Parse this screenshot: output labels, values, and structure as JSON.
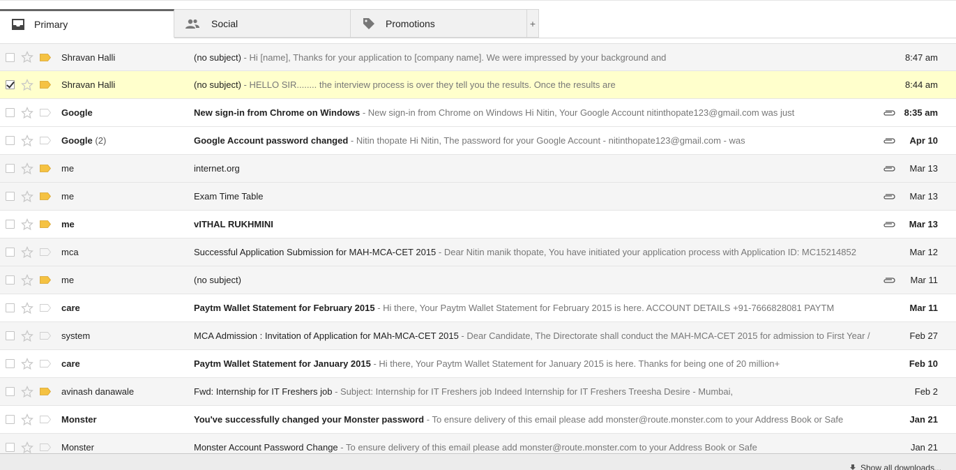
{
  "tabs": [
    {
      "label": "Primary",
      "icon": "inbox-icon"
    },
    {
      "label": "Social",
      "icon": "people-icon"
    },
    {
      "label": "Promotions",
      "icon": "tag-icon"
    }
  ],
  "tab_add_label": "+",
  "emails": [
    {
      "sender": "Shravan Halli",
      "count": "",
      "subject": "(no subject)",
      "snippet": " - Hi [name], Thanks for your application to [company name]. We were impressed by your background and",
      "date": "8:47 am",
      "unread": false,
      "selected": false,
      "checked": false,
      "important": true,
      "attachment": false
    },
    {
      "sender": "Shravan Halli",
      "count": "",
      "subject": "(no subject)",
      "snippet": " - HELLO SIR........ the interview process is over they tell you the results. Once the results are",
      "date": "8:44 am",
      "unread": false,
      "selected": true,
      "checked": true,
      "important": true,
      "attachment": false
    },
    {
      "sender": "Google",
      "count": "",
      "subject": "New sign-in from Chrome on Windows",
      "snippet": " - New sign-in from Chrome on Windows Hi Nitin, Your Google Account nitinthopate123@gmail.com was just",
      "date": "8:35 am",
      "unread": true,
      "selected": false,
      "checked": false,
      "important": false,
      "attachment": true
    },
    {
      "sender": "Google",
      "count": " (2)",
      "subject": "Google Account password changed",
      "snippet": " - Nitin thopate Hi Nitin, The password for your Google Account - nitinthopate123@gmail.com - was",
      "date": "Apr 10",
      "unread": true,
      "selected": false,
      "checked": false,
      "important": false,
      "attachment": true
    },
    {
      "sender": "me",
      "count": "",
      "subject": "internet.org",
      "snippet": "",
      "date": "Mar 13",
      "unread": false,
      "selected": false,
      "checked": false,
      "important": true,
      "attachment": true
    },
    {
      "sender": "me",
      "count": "",
      "subject": "Exam Time Table",
      "snippet": "",
      "date": "Mar 13",
      "unread": false,
      "selected": false,
      "checked": false,
      "important": true,
      "attachment": true
    },
    {
      "sender": "me",
      "count": "",
      "subject": "vITHAL RUKHMINI",
      "snippet": "",
      "date": "Mar 13",
      "unread": true,
      "selected": false,
      "checked": false,
      "important": true,
      "attachment": true
    },
    {
      "sender": "mca",
      "count": "",
      "subject": "Successful Application Submission for MAH-MCA-CET 2015",
      "snippet": " - Dear Nitin manik thopate, You have initiated your application process with Application ID: MC15214852",
      "date": "Mar 12",
      "unread": false,
      "selected": false,
      "checked": false,
      "important": false,
      "attachment": false
    },
    {
      "sender": "me",
      "count": "",
      "subject": "(no subject)",
      "snippet": "",
      "date": "Mar 11",
      "unread": false,
      "selected": false,
      "checked": false,
      "important": true,
      "attachment": true
    },
    {
      "sender": "care",
      "count": "",
      "subject": "Paytm Wallet Statement for February 2015",
      "snippet": " - Hi there, Your Paytm Wallet Statement for February 2015 is here. ACCOUNT DETAILS +91-7666828081 PAYTM",
      "date": "Mar 11",
      "unread": true,
      "selected": false,
      "checked": false,
      "important": false,
      "attachment": false
    },
    {
      "sender": "system",
      "count": "",
      "subject": "MCA Admission : Invitation of Application for MAh-MCA-CET 2015",
      "snippet": " - Dear Candidate, The Directorate shall conduct the MAH-MCA-CET 2015 for admission to First Year /",
      "date": "Feb 27",
      "unread": false,
      "selected": false,
      "checked": false,
      "important": false,
      "attachment": false
    },
    {
      "sender": "care",
      "count": "",
      "subject": "Paytm Wallet Statement for January 2015",
      "snippet": " - Hi there, Your Paytm Wallet Statement for January 2015 is here. Thanks for being one of 20 million+",
      "date": "Feb 10",
      "unread": true,
      "selected": false,
      "checked": false,
      "important": false,
      "attachment": false
    },
    {
      "sender": "avinash danawale",
      "count": "",
      "subject": "Fwd: Internship for IT Freshers job",
      "snippet": " - Subject: Internship for IT Freshers job Indeed Internship for IT Freshers Treesha Desire - Mumbai,",
      "date": "Feb 2",
      "unread": false,
      "selected": false,
      "checked": false,
      "important": true,
      "attachment": false
    },
    {
      "sender": "Monster",
      "count": "",
      "subject": "You've successfully changed your Monster password",
      "snippet": " - To ensure delivery of this email please add monster@route.monster.com to your Address Book or Safe",
      "date": "Jan 21",
      "unread": true,
      "selected": false,
      "checked": false,
      "important": false,
      "attachment": false
    },
    {
      "sender": "Monster",
      "count": "",
      "subject": "Monster Account Password Change",
      "snippet": " - To ensure delivery of this email please add monster@route.monster.com to your Address Book or Safe",
      "date": "Jan 21",
      "unread": false,
      "selected": false,
      "checked": false,
      "important": false,
      "attachment": false
    }
  ],
  "downloads_bar": {
    "label": "Show all downloads...",
    "icon": "download-icon"
  },
  "colors": {
    "important_marker": "#f5c242",
    "selected_row": "#ffffcc",
    "read_row": "#f5f5f5",
    "unread_row": "#ffffff"
  }
}
